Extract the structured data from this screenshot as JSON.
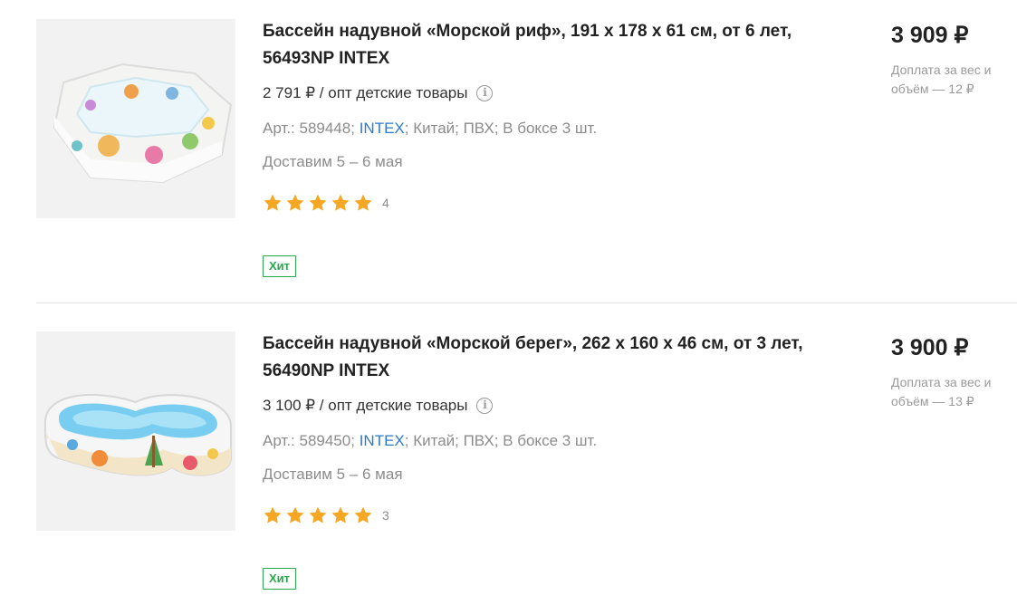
{
  "products": [
    {
      "title": "Бассейн надувной «Морской риф», 191 x 178 x 61 см, от 6 лет, 56493NP INTEX",
      "wholesale_price": "2 791 ₽ / опт детские товары",
      "article_prefix": "Арт.: 589448;",
      "brand": "INTEX",
      "article_suffix": "; Китай; ПВХ; В боксе 3 шт.",
      "delivery": "Доставим 5 – 6 мая",
      "rating_stars": 5,
      "rating_count": "4",
      "badge": "Хит",
      "price": "3 909 ₽",
      "extra_fee": "Доплата за вес и объём — 12 ₽"
    },
    {
      "title": "Бассейн надувной «Морской берег», 262 x 160 x 46 см, от 3 лет, 56490NP INTEX",
      "wholesale_price": "3 100 ₽ / опт детские товары",
      "article_prefix": "Арт.: 589450;",
      "brand": "INTEX",
      "article_suffix": "; Китай; ПВХ; В боксе 3 шт.",
      "delivery": "Доставим 5 – 6 мая",
      "rating_stars": 5,
      "rating_count": "3",
      "badge": "Хит",
      "price": "3 900 ₽",
      "extra_fee": "Доплата за вес и объём — 13 ₽"
    }
  ],
  "colors": {
    "star": "#f5a623",
    "badge": "#2aa84a",
    "brand_link": "#2e7bc4"
  }
}
